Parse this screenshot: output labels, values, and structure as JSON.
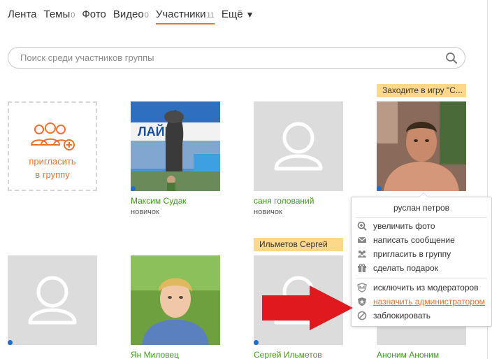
{
  "tabs": [
    {
      "label": "Лента",
      "count": ""
    },
    {
      "label": "Темы",
      "count": "0"
    },
    {
      "label": "Фото",
      "count": ""
    },
    {
      "label": "Видео",
      "count": "0"
    },
    {
      "label": "Участники",
      "count": "11"
    },
    {
      "label": "Ещё",
      "count": ""
    }
  ],
  "search": {
    "placeholder": "Поиск среди участников группы"
  },
  "invite": {
    "label_line1": "пригласить",
    "label_line2": "в группу"
  },
  "members": [
    {
      "name": "Максим Судак",
      "status": "новичок"
    },
    {
      "name": "саня голований",
      "status": "новичок"
    },
    {
      "name": "руслан петров",
      "badge": "Заходите в игру \"С..."
    },
    {
      "name": "",
      "status": ""
    },
    {
      "name": "Ян Миловец",
      "status": ""
    },
    {
      "name": "Сергей Ильметов",
      "badge": "Ильметов Сергей"
    },
    {
      "name": "Аноним Аноним",
      "status": ""
    }
  ],
  "popup": {
    "title": "руслан петров",
    "items": [
      {
        "icon": "zoom-in-icon",
        "label": "увеличить фото"
      },
      {
        "icon": "envelope-icon",
        "label": "написать сообщение"
      },
      {
        "icon": "group-icon",
        "label": "пригласить в группу"
      },
      {
        "icon": "gift-icon",
        "label": "сделать подарок"
      },
      {
        "icon": "moderator-icon",
        "label": "исключить из модераторов"
      },
      {
        "icon": "shield-icon",
        "label": "назначить администратором"
      },
      {
        "icon": "block-icon",
        "label": "заблокировать"
      }
    ]
  },
  "colors": {
    "accent": "#eb722e",
    "name_green": "#3f9d18",
    "badge_bg": "#fdd88a",
    "online_dot": "#1a6fd0",
    "arrow_red": "#e0191f"
  }
}
